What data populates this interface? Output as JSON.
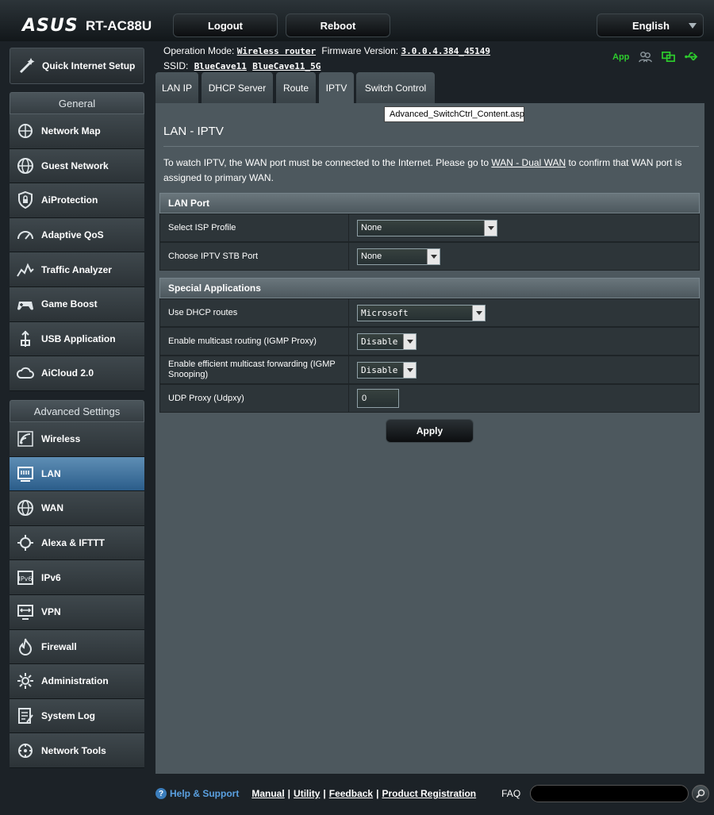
{
  "brand": {
    "logo": "ASUS",
    "model": "RT-AC88U"
  },
  "top": {
    "logout": "Logout",
    "reboot": "Reboot",
    "language": "English"
  },
  "info": {
    "mode_label": "Operation Mode:",
    "mode_value": "Wireless router",
    "firmware_label": "Firmware Version:",
    "firmware_value": "3.0.0.4.384_45149",
    "ssid_label": "SSID:",
    "ssid_1": "BlueCave11",
    "ssid_2": "BlueCave11_5G",
    "status_app": "App"
  },
  "sidebar": {
    "quick_setup": "Quick Internet Setup",
    "general_header": "General",
    "general": [
      {
        "label": "Network Map",
        "icon": "network-map-icon"
      },
      {
        "label": "Guest Network",
        "icon": "globe-icon"
      },
      {
        "label": "AiProtection",
        "icon": "lock-shield-icon"
      },
      {
        "label": "Adaptive QoS",
        "icon": "speedometer-icon"
      },
      {
        "label": "Traffic Analyzer",
        "icon": "traffic-chart-icon"
      },
      {
        "label": "Game Boost",
        "icon": "gamepad-icon"
      },
      {
        "label": "USB Application",
        "icon": "usb-icon"
      },
      {
        "label": "AiCloud 2.0",
        "icon": "cloud-icon"
      }
    ],
    "advanced_header": "Advanced Settings",
    "advanced": [
      {
        "label": "Wireless",
        "icon": "wifi-icon"
      },
      {
        "label": "LAN",
        "icon": "lan-icon",
        "active": true
      },
      {
        "label": "WAN",
        "icon": "globe-icon"
      },
      {
        "label": "Alexa & IFTTT",
        "icon": "alexa-icon"
      },
      {
        "label": "IPv6",
        "icon": "ipv6-icon"
      },
      {
        "label": "VPN",
        "icon": "vpn-icon"
      },
      {
        "label": "Firewall",
        "icon": "fire-icon"
      },
      {
        "label": "Administration",
        "icon": "gear-icon"
      },
      {
        "label": "System Log",
        "icon": "log-icon"
      },
      {
        "label": "Network Tools",
        "icon": "tools-icon"
      }
    ]
  },
  "tabs": [
    {
      "label": "LAN IP"
    },
    {
      "label": "DHCP Server"
    },
    {
      "label": "Route"
    },
    {
      "label": "IPTV",
      "active": true
    },
    {
      "label": "Switch Control"
    }
  ],
  "tooltip": "Advanced_SwitchCtrl_Content.asp",
  "page": {
    "title": "LAN - IPTV",
    "desc_before": "To watch IPTV, the WAN port must be connected to the Internet. Please go to ",
    "desc_link": "WAN - Dual WAN",
    "desc_after": " to confirm that WAN port is assigned to primary WAN."
  },
  "lan_port": {
    "header": "LAN Port",
    "isp_profile_label": "Select ISP Profile",
    "isp_profile_value": "None",
    "stb_port_label": "Choose IPTV STB Port",
    "stb_port_value": "None"
  },
  "special": {
    "header": "Special Applications",
    "dhcp_routes_label": "Use DHCP routes",
    "dhcp_routes_value": "Microsoft",
    "igmp_proxy_label": "Enable multicast routing (IGMP Proxy)",
    "igmp_proxy_value": "Disable",
    "igmp_snooping_label": "Enable efficient multicast forwarding (IGMP Snooping)",
    "igmp_snooping_value": "Disable",
    "udpxy_label": "UDP Proxy (Udpxy)",
    "udpxy_value": "0"
  },
  "apply": "Apply",
  "footer": {
    "help": "Help & Support",
    "manual": "Manual",
    "utility": "Utility",
    "feedback": "Feedback",
    "registration": "Product Registration",
    "faq": "FAQ"
  }
}
